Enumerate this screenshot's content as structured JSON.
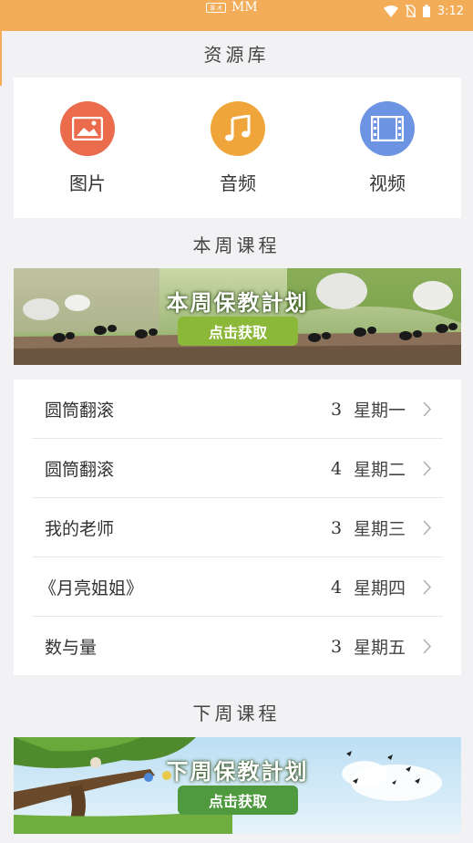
{
  "status_bar": {
    "app_box_label": "课 术",
    "app_name": "MM",
    "time": "3:12",
    "bg_color": "#f3ac58"
  },
  "resource_section": {
    "title": "资源库",
    "items": [
      {
        "label": "图片",
        "icon": "image-icon",
        "color": "#ea6c4d"
      },
      {
        "label": "音频",
        "icon": "music-icon",
        "color": "#f0a53a"
      },
      {
        "label": "视频",
        "icon": "video-icon",
        "color": "#6d93e3"
      }
    ]
  },
  "this_week": {
    "title": "本周课程",
    "banner": {
      "title": "本周保教計划",
      "button": "点击获取",
      "button_color": "#8cb83a"
    },
    "courses": [
      {
        "name": "圆筒翻滚",
        "count": "3",
        "day": "星期一"
      },
      {
        "name": "圆筒翻滚",
        "count": "4",
        "day": "星期二"
      },
      {
        "name": "我的老师",
        "count": "3",
        "day": "星期三"
      },
      {
        "name": "《月亮姐姐》",
        "count": "4",
        "day": "星期四"
      },
      {
        "name": "数与量",
        "count": "3",
        "day": "星期五"
      }
    ]
  },
  "next_week": {
    "title": "下周课程",
    "banner": {
      "title": "下周保教計划",
      "button": "点击获取",
      "button_color": "#4f9a3e"
    }
  }
}
